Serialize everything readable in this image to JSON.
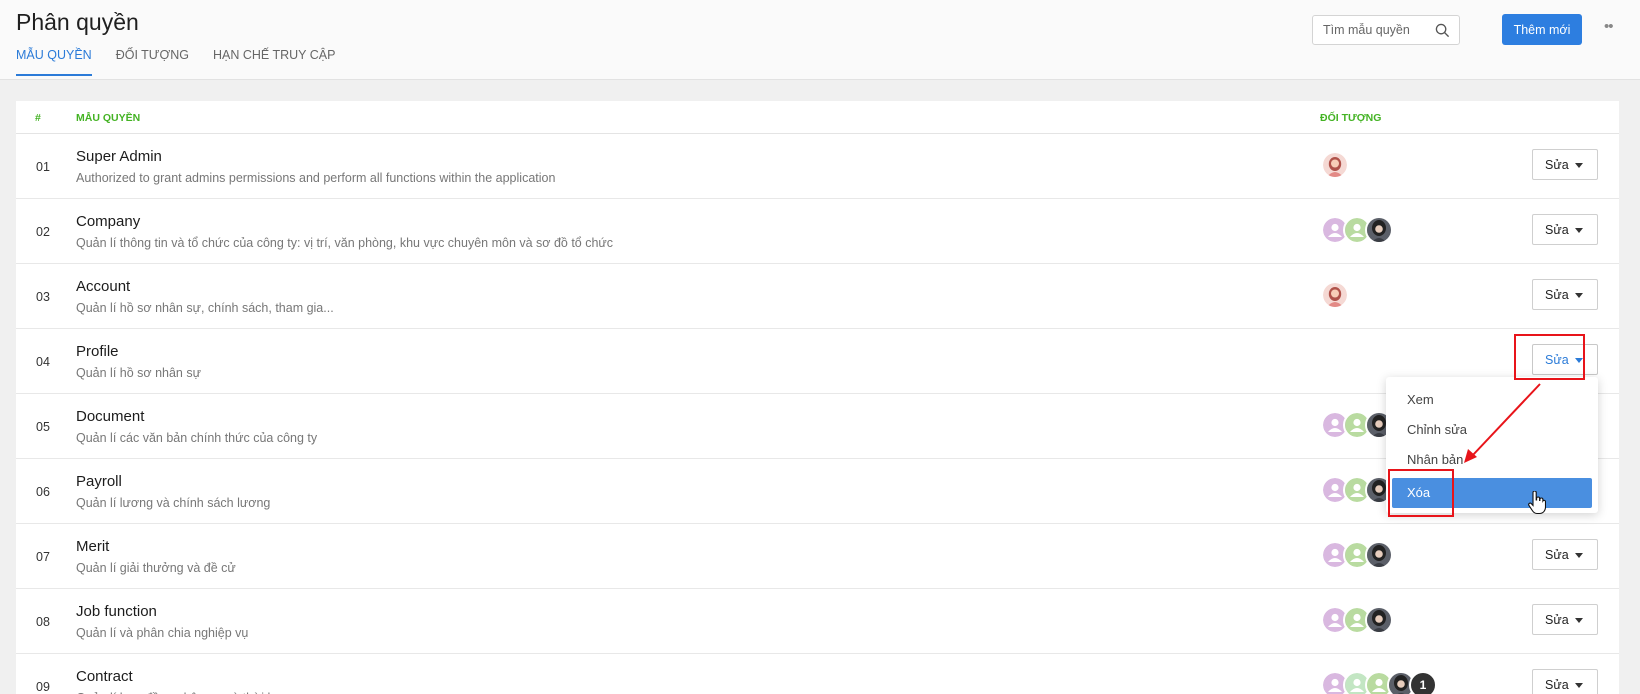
{
  "header": {
    "title": "Phân quyền",
    "tabs": [
      {
        "label": "MẪU QUYỀN"
      },
      {
        "label": "ĐỐI TƯỢNG"
      },
      {
        "label": "HẠN CHẾ TRUY CẬP"
      }
    ],
    "search_placeholder": "Tìm mẫu quyền",
    "add_label": "Thêm mới"
  },
  "table": {
    "col_num": "#",
    "col_template": "MẪU QUYỀN",
    "col_subjects": "ĐỐI TƯỢNG",
    "edit_label": "Sửa",
    "rows": [
      {
        "num": "01",
        "name": "Super Admin",
        "desc": "Authorized to grant admins permissions and perform all functions within the application",
        "avatars": [
          "female"
        ]
      },
      {
        "num": "02",
        "name": "Company",
        "desc": "Quản lí thông tin và tổ chức của công ty: vị trí, văn phòng, khu vực chuyên môn và sơ đồ tổ chức",
        "avatars": [
          "purple",
          "green",
          "photo"
        ]
      },
      {
        "num": "03",
        "name": "Account",
        "desc": "Quản lí hồ sơ nhân sự, chính sách, tham gia...",
        "avatars": [
          "female"
        ]
      },
      {
        "num": "04",
        "name": "Profile",
        "desc": "Quản lí hồ sơ nhân sự",
        "avatars": []
      },
      {
        "num": "05",
        "name": "Document",
        "desc": "Quản lí các văn bản chính thức của công ty",
        "avatars": [
          "purple",
          "green",
          "photo"
        ]
      },
      {
        "num": "06",
        "name": "Payroll",
        "desc": "Quản lí lương và chính sách lương",
        "avatars": [
          "purple",
          "green",
          "photo"
        ]
      },
      {
        "num": "07",
        "name": "Merit",
        "desc": "Quản lí giải thưởng và đề cử",
        "avatars": [
          "purple",
          "green",
          "photo"
        ]
      },
      {
        "num": "08",
        "name": "Job function",
        "desc": "Quản lí và phân chia nghiệp vụ",
        "avatars": [
          "purple",
          "green",
          "photo"
        ]
      },
      {
        "num": "09",
        "name": "Contract",
        "desc": "Quản lí hợp đồng nhân sự và thời hạn",
        "avatars": [
          "purple",
          "mint",
          "green",
          "photo",
          "count"
        ],
        "extra_count": "1"
      }
    ]
  },
  "dropdown": {
    "items": [
      {
        "label": "Xem"
      },
      {
        "label": "Chỉnh sửa"
      },
      {
        "label": "Nhân bản"
      },
      {
        "label": "Xóa"
      }
    ]
  },
  "colors": {
    "primary": "#2d7ee0",
    "header_green": "#44b324",
    "highlight_red": "#e8141a",
    "menu_active": "#4a8fe0"
  }
}
